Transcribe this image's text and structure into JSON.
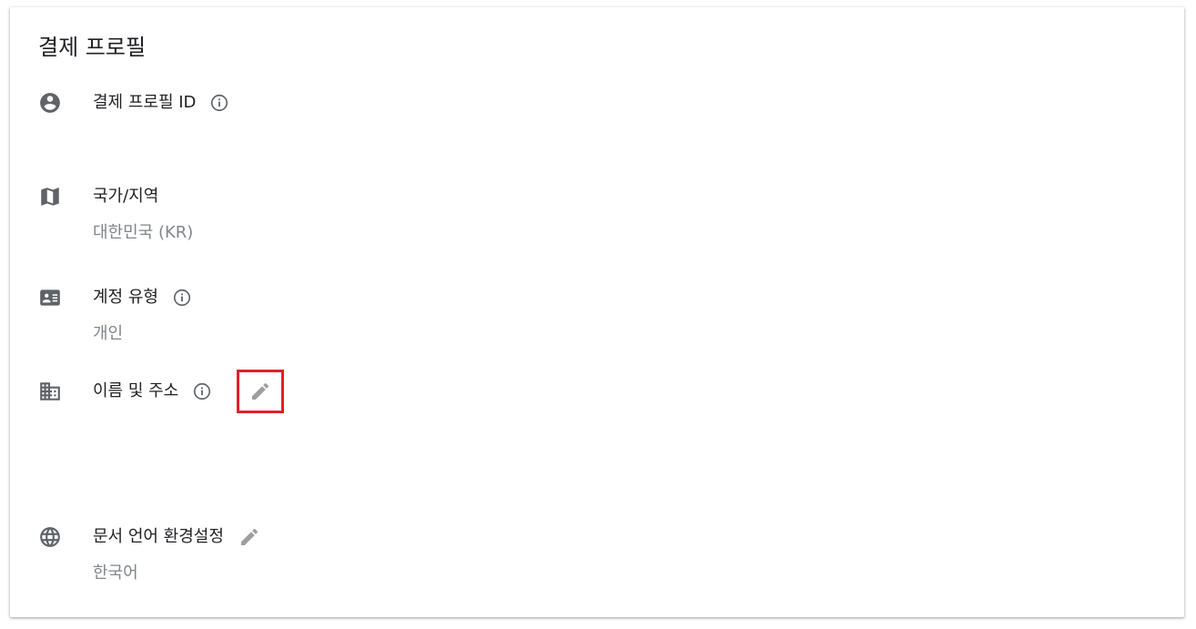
{
  "card": {
    "title": "결제 프로필"
  },
  "sections": [
    {
      "id": "payments-profile-id",
      "label": "결제 프로필 ID",
      "icon": "account-circle-icon",
      "has_info": true,
      "has_edit": false,
      "value": ""
    },
    {
      "id": "country",
      "label": "국가/지역",
      "icon": "map-icon",
      "has_info": false,
      "has_edit": false,
      "value": "대한민국 (KR)"
    },
    {
      "id": "account-type",
      "label": "계정 유형",
      "icon": "id-card-icon",
      "has_info": true,
      "has_edit": false,
      "value": "개인"
    },
    {
      "id": "name-address",
      "label": "이름 및 주소",
      "icon": "business-icon",
      "has_info": true,
      "has_edit": true,
      "edit_highlighted": true,
      "value": ""
    },
    {
      "id": "document-language",
      "label": "문서 언어 환경설정",
      "icon": "globe-icon",
      "has_info": false,
      "has_edit": true,
      "value": "한국어"
    }
  ],
  "colors": {
    "icon": "#5f6368",
    "edit_icon": "#9e9e9e",
    "label": "#202124",
    "value": "#80868b",
    "highlight": "#e0202b"
  }
}
